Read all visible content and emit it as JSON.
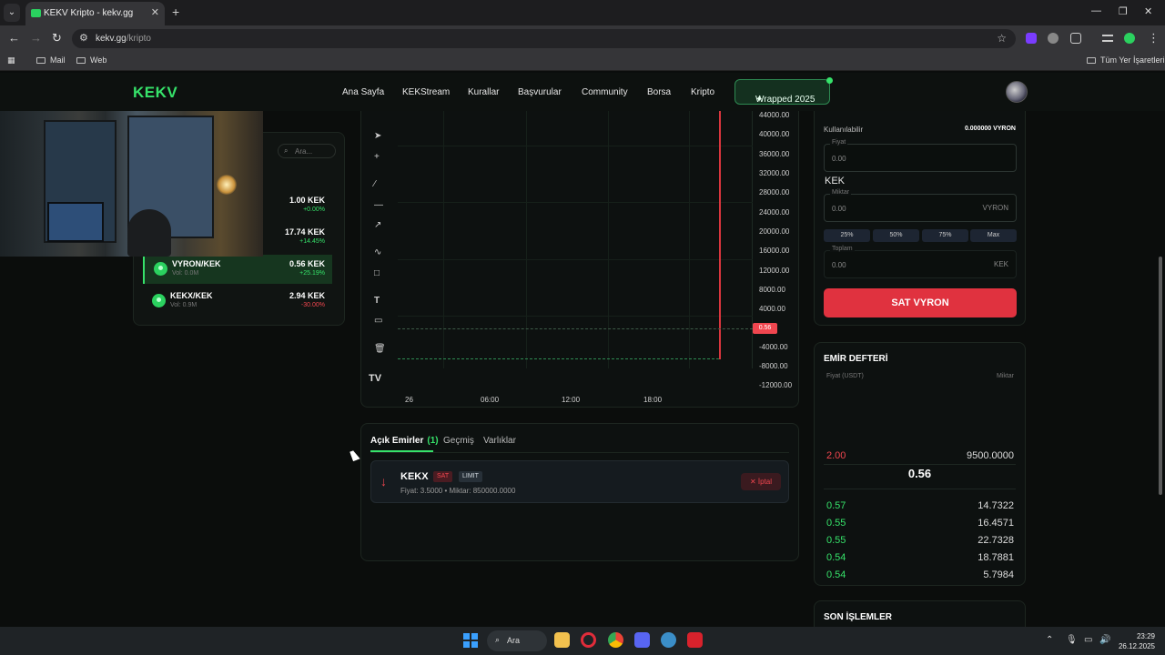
{
  "browser": {
    "tab_title": "KEKV Kripto - kekv.gg",
    "url_domain": "kekv.gg",
    "url_path": "/kripto",
    "bookmarks": [
      "Mail",
      "Web"
    ],
    "all_bookmarks": "Tüm Yer İşaretleri"
  },
  "header": {
    "logo": "KEKV",
    "nav": [
      "Ana Sayfa",
      "KEKStream",
      "Kurallar",
      "Başvurular",
      "Community",
      "Borsa",
      "Kripto"
    ],
    "wrapped": "Wrapped 2025"
  },
  "markets": {
    "search_placeholder": "Ara...",
    "rows": [
      {
        "name": "",
        "vol": "",
        "price": "1.00 KEK",
        "change": "+0.00%",
        "dir": "up"
      },
      {
        "name": "",
        "vol": "",
        "price": "17.74 KEK",
        "change": "+14.45%",
        "dir": "up"
      },
      {
        "name": "VYRON/KEK",
        "vol": "Vol: 0.0M",
        "price": "0.56 KEK",
        "change": "+25.19%",
        "dir": "up"
      },
      {
        "name": "KEKX/KEK",
        "vol": "Vol: 0.9M",
        "price": "2.94 KEK",
        "change": "-30.00%",
        "dir": "down"
      }
    ]
  },
  "chart": {
    "y_ticks": [
      "44000.00",
      "40000.00",
      "36000.00",
      "32000.00",
      "28000.00",
      "24000.00",
      "20000.00",
      "16000.00",
      "12000.00",
      "8000.00",
      "4000.00",
      "-4000.00",
      "-8000.00",
      "-12000.00"
    ],
    "x_ticks": [
      "26",
      "06:00",
      "12:00",
      "18:00"
    ],
    "last_price": "0.56",
    "tv_logo": "TV"
  },
  "orders": {
    "tabs": [
      "Açık Emirler",
      "Geçmiş",
      "Varlıklar"
    ],
    "open_count": "(1)",
    "order": {
      "symbol": "KEKX",
      "side": "SAT",
      "type": "LIMIT",
      "detail": "Fiyat: 3.5000 • Miktar: 850000.0000",
      "cancel": "İptal"
    }
  },
  "trade": {
    "available_label": "Kullanılabilir",
    "available_value": "0.000000 VYRON",
    "price_label": "Fiyat",
    "price_value": "0.00",
    "price_unit": "KEK",
    "amount_label": "Miktar",
    "amount_value": "0.00",
    "amount_unit": "VYRON",
    "pct": [
      "25%",
      "50%",
      "75%",
      "Max"
    ],
    "total_label": "Toplam",
    "total_value": "0.00",
    "total_unit": "KEK",
    "submit": "SAT VYRON"
  },
  "orderbook": {
    "title": "EMİR DEFTERİ",
    "col_price": "Fiyat (USDT)",
    "col_amount": "Miktar",
    "asks": [
      {
        "price": "2.00",
        "amount": "9500.0000"
      }
    ],
    "mid": "0.56",
    "bids": [
      {
        "price": "0.57",
        "amount": "14.7322"
      },
      {
        "price": "0.55",
        "amount": "16.4571"
      },
      {
        "price": "0.55",
        "amount": "22.7328"
      },
      {
        "price": "0.54",
        "amount": "18.7881"
      },
      {
        "price": "0.54",
        "amount": "5.7984"
      }
    ]
  },
  "last_trades": {
    "title": "SON İŞLEMLER"
  },
  "taskbar": {
    "search": "Ara",
    "time": "23:29",
    "date": "26.12.2025"
  },
  "colors": {
    "accent": "#36e26a",
    "sell": "#e0323f",
    "background": "#0b0d0c"
  }
}
